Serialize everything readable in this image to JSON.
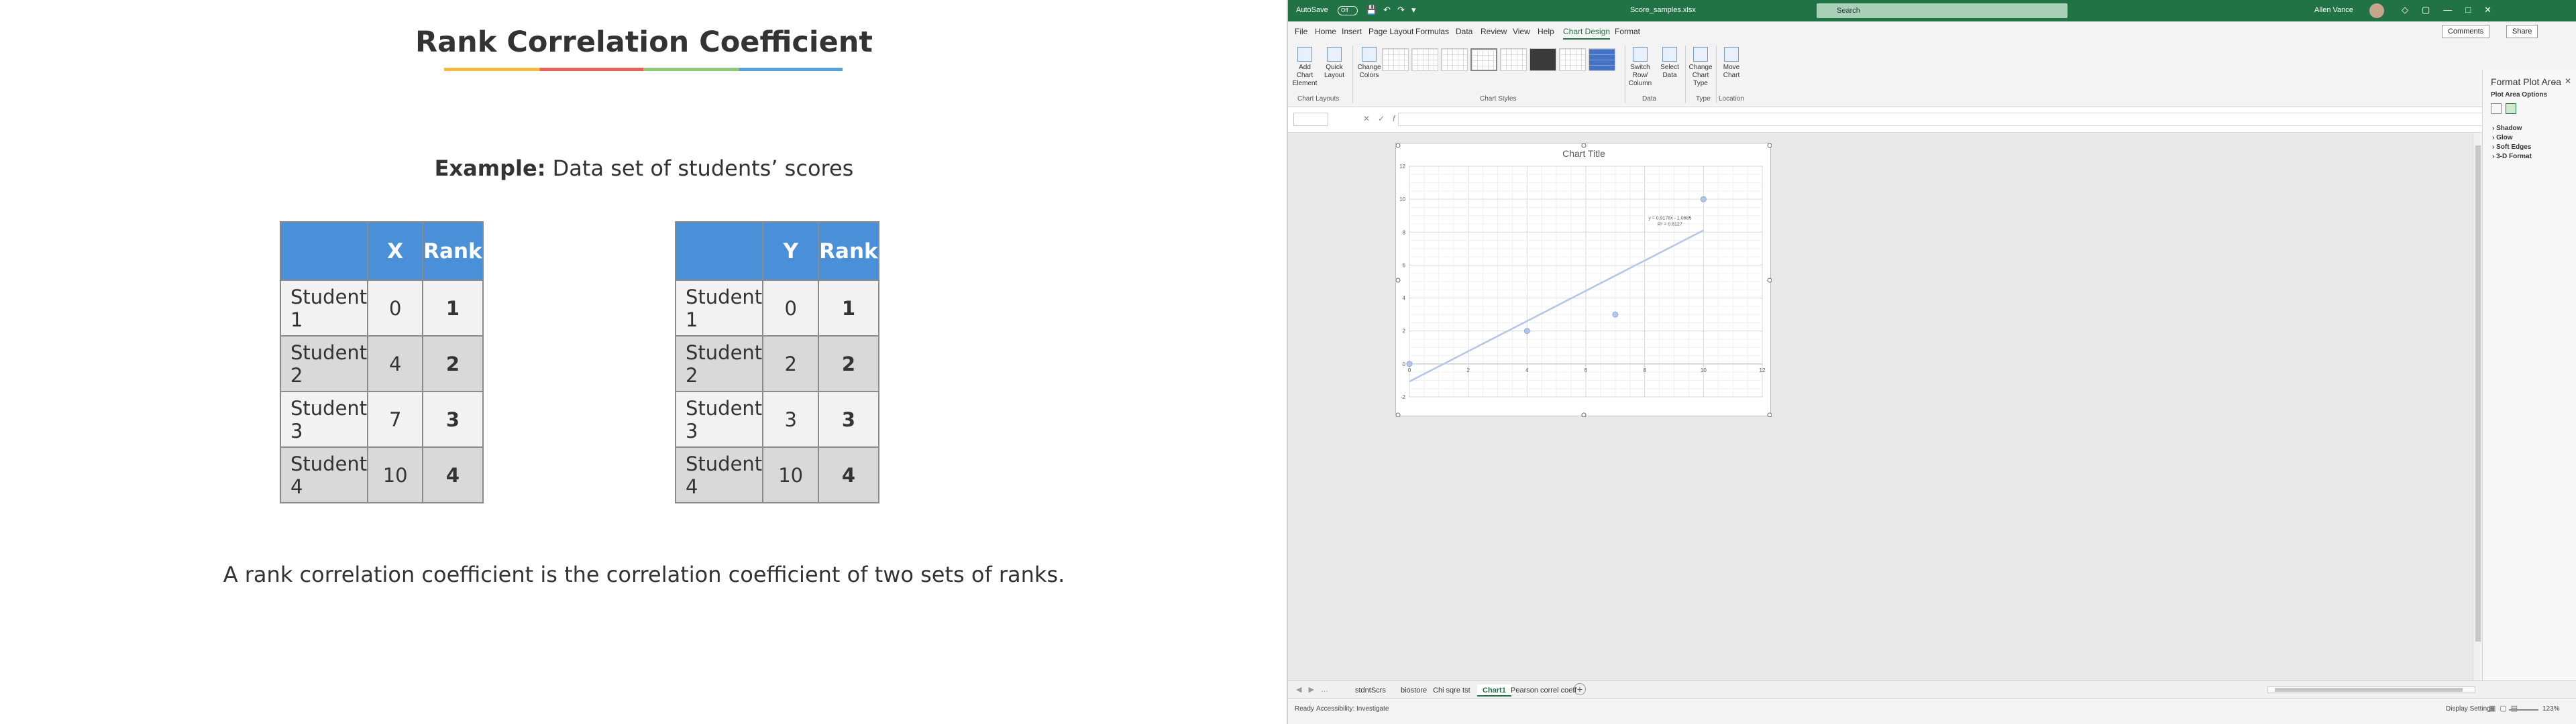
{
  "slide": {
    "title": "Rank Correlation Coefficient",
    "example_bold": "Example:",
    "example_text": " Data set of students’ scores",
    "caption": "A rank correlation coefficient is the correlation coefficient of two sets of ranks.",
    "table_x": {
      "headers": [
        "",
        "X",
        "Rank"
      ],
      "rows": [
        [
          "Student 1",
          "0",
          "1"
        ],
        [
          "Student 2",
          "4",
          "2"
        ],
        [
          "Student 3",
          "7",
          "3"
        ],
        [
          "Student 4",
          "10",
          "4"
        ]
      ]
    },
    "table_y": {
      "headers": [
        "",
        "Y",
        "Rank"
      ],
      "rows": [
        [
          "Student 1",
          "0",
          "1"
        ],
        [
          "Student 2",
          "2",
          "2"
        ],
        [
          "Student 3",
          "3",
          "3"
        ],
        [
          "Student 4",
          "10",
          "4"
        ]
      ]
    }
  },
  "excel": {
    "colors": {
      "brand": "#217346",
      "marker": "#b4c6e7",
      "trendline": "#b4c6e7"
    },
    "titlebar": {
      "autosave": "AutoSave",
      "toggle": "Off",
      "filename": "Score_samples.xlsx",
      "search_placeholder": "Search",
      "user": "Allen Vance"
    },
    "menu": [
      "File",
      "Home",
      "Insert",
      "Page Layout",
      "Formulas",
      "Data",
      "Review",
      "View",
      "Help",
      "Chart Design",
      "Format"
    ],
    "active_menu": "Chart Design",
    "comments": "Comments",
    "share": "Share",
    "ribbon": {
      "add_chart_element": "Add Chart Element",
      "quick_layout": "Quick Layout",
      "change_colors": "Change Colors",
      "switch_row_column": "Switch Row/ Column",
      "select_data": "Select Data",
      "change_chart_type": "Change Chart Type",
      "move_chart": "Move Chart",
      "groups": [
        "Chart Layouts",
        "Chart Styles",
        "Data",
        "Type",
        "Location"
      ]
    },
    "format_pane": {
      "title": "Format Plot Area",
      "options": "Plot Area Options",
      "items": [
        "Shadow",
        "Glow",
        "Soft Edges",
        "3-D Format"
      ]
    },
    "sheet_tabs": [
      "stdntScrs",
      "biostore",
      "Chi sqre tst",
      "Chart1",
      "Pearson correl coeff"
    ],
    "active_tab": "Chart1",
    "status": {
      "ready": "Ready",
      "accessibility": "Accessibility: Investigate",
      "display_settings": "Display Settings",
      "zoom": "123%"
    }
  },
  "chart_data": {
    "type": "scatter",
    "title": "Chart Title",
    "x": [
      0,
      4,
      7,
      10
    ],
    "y": [
      0,
      2,
      3,
      10
    ],
    "xlim": [
      0,
      12
    ],
    "ylim": [
      -2,
      12
    ],
    "xticks": [
      "0",
      "2",
      "4",
      "6",
      "8",
      "10",
      "12"
    ],
    "yticks": [
      "-2",
      "0",
      "2",
      "4",
      "6",
      "8",
      "10",
      "12"
    ],
    "grid": true,
    "trendline": {
      "slope": 0.9178,
      "intercept": -1.0685,
      "equation": "y = 0.9178x - 1.0685",
      "r2": "R² = 0.8127"
    }
  }
}
